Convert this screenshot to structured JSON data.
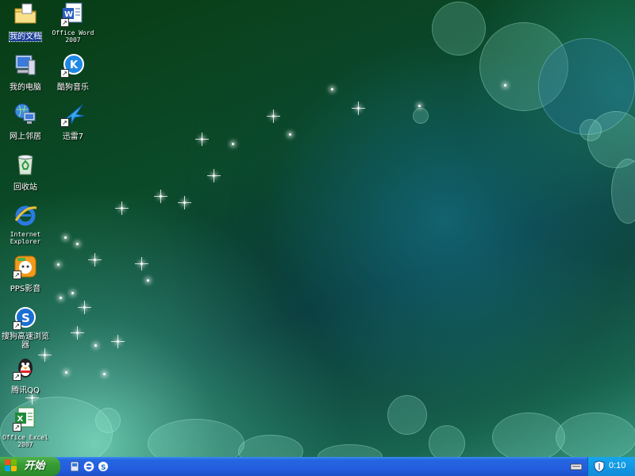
{
  "desktop": {
    "icons": [
      {
        "label": "我的文档"
      },
      {
        "label": "Office Word 2007"
      },
      {
        "label": "我的电脑"
      },
      {
        "label": "酷狗音乐"
      },
      {
        "label": "网上邻居"
      },
      {
        "label": "迅雷7"
      },
      {
        "label": "回收站"
      },
      {
        "label": "Internet Explorer"
      },
      {
        "label": "PPS影音"
      },
      {
        "label": "搜狗高速浏览器"
      },
      {
        "label": "腾讯QQ"
      },
      {
        "label": "Office Excel 2007"
      }
    ]
  },
  "taskbar": {
    "start_label": "开始",
    "quick_launch": [
      "show-desktop-icon",
      "ie-icon",
      "sogou-icon"
    ],
    "tray": {
      "clock": "0:10"
    }
  },
  "colors": {
    "taskbar": "#245ee0",
    "start": "#379d34",
    "tray": "#0f8bd8"
  }
}
